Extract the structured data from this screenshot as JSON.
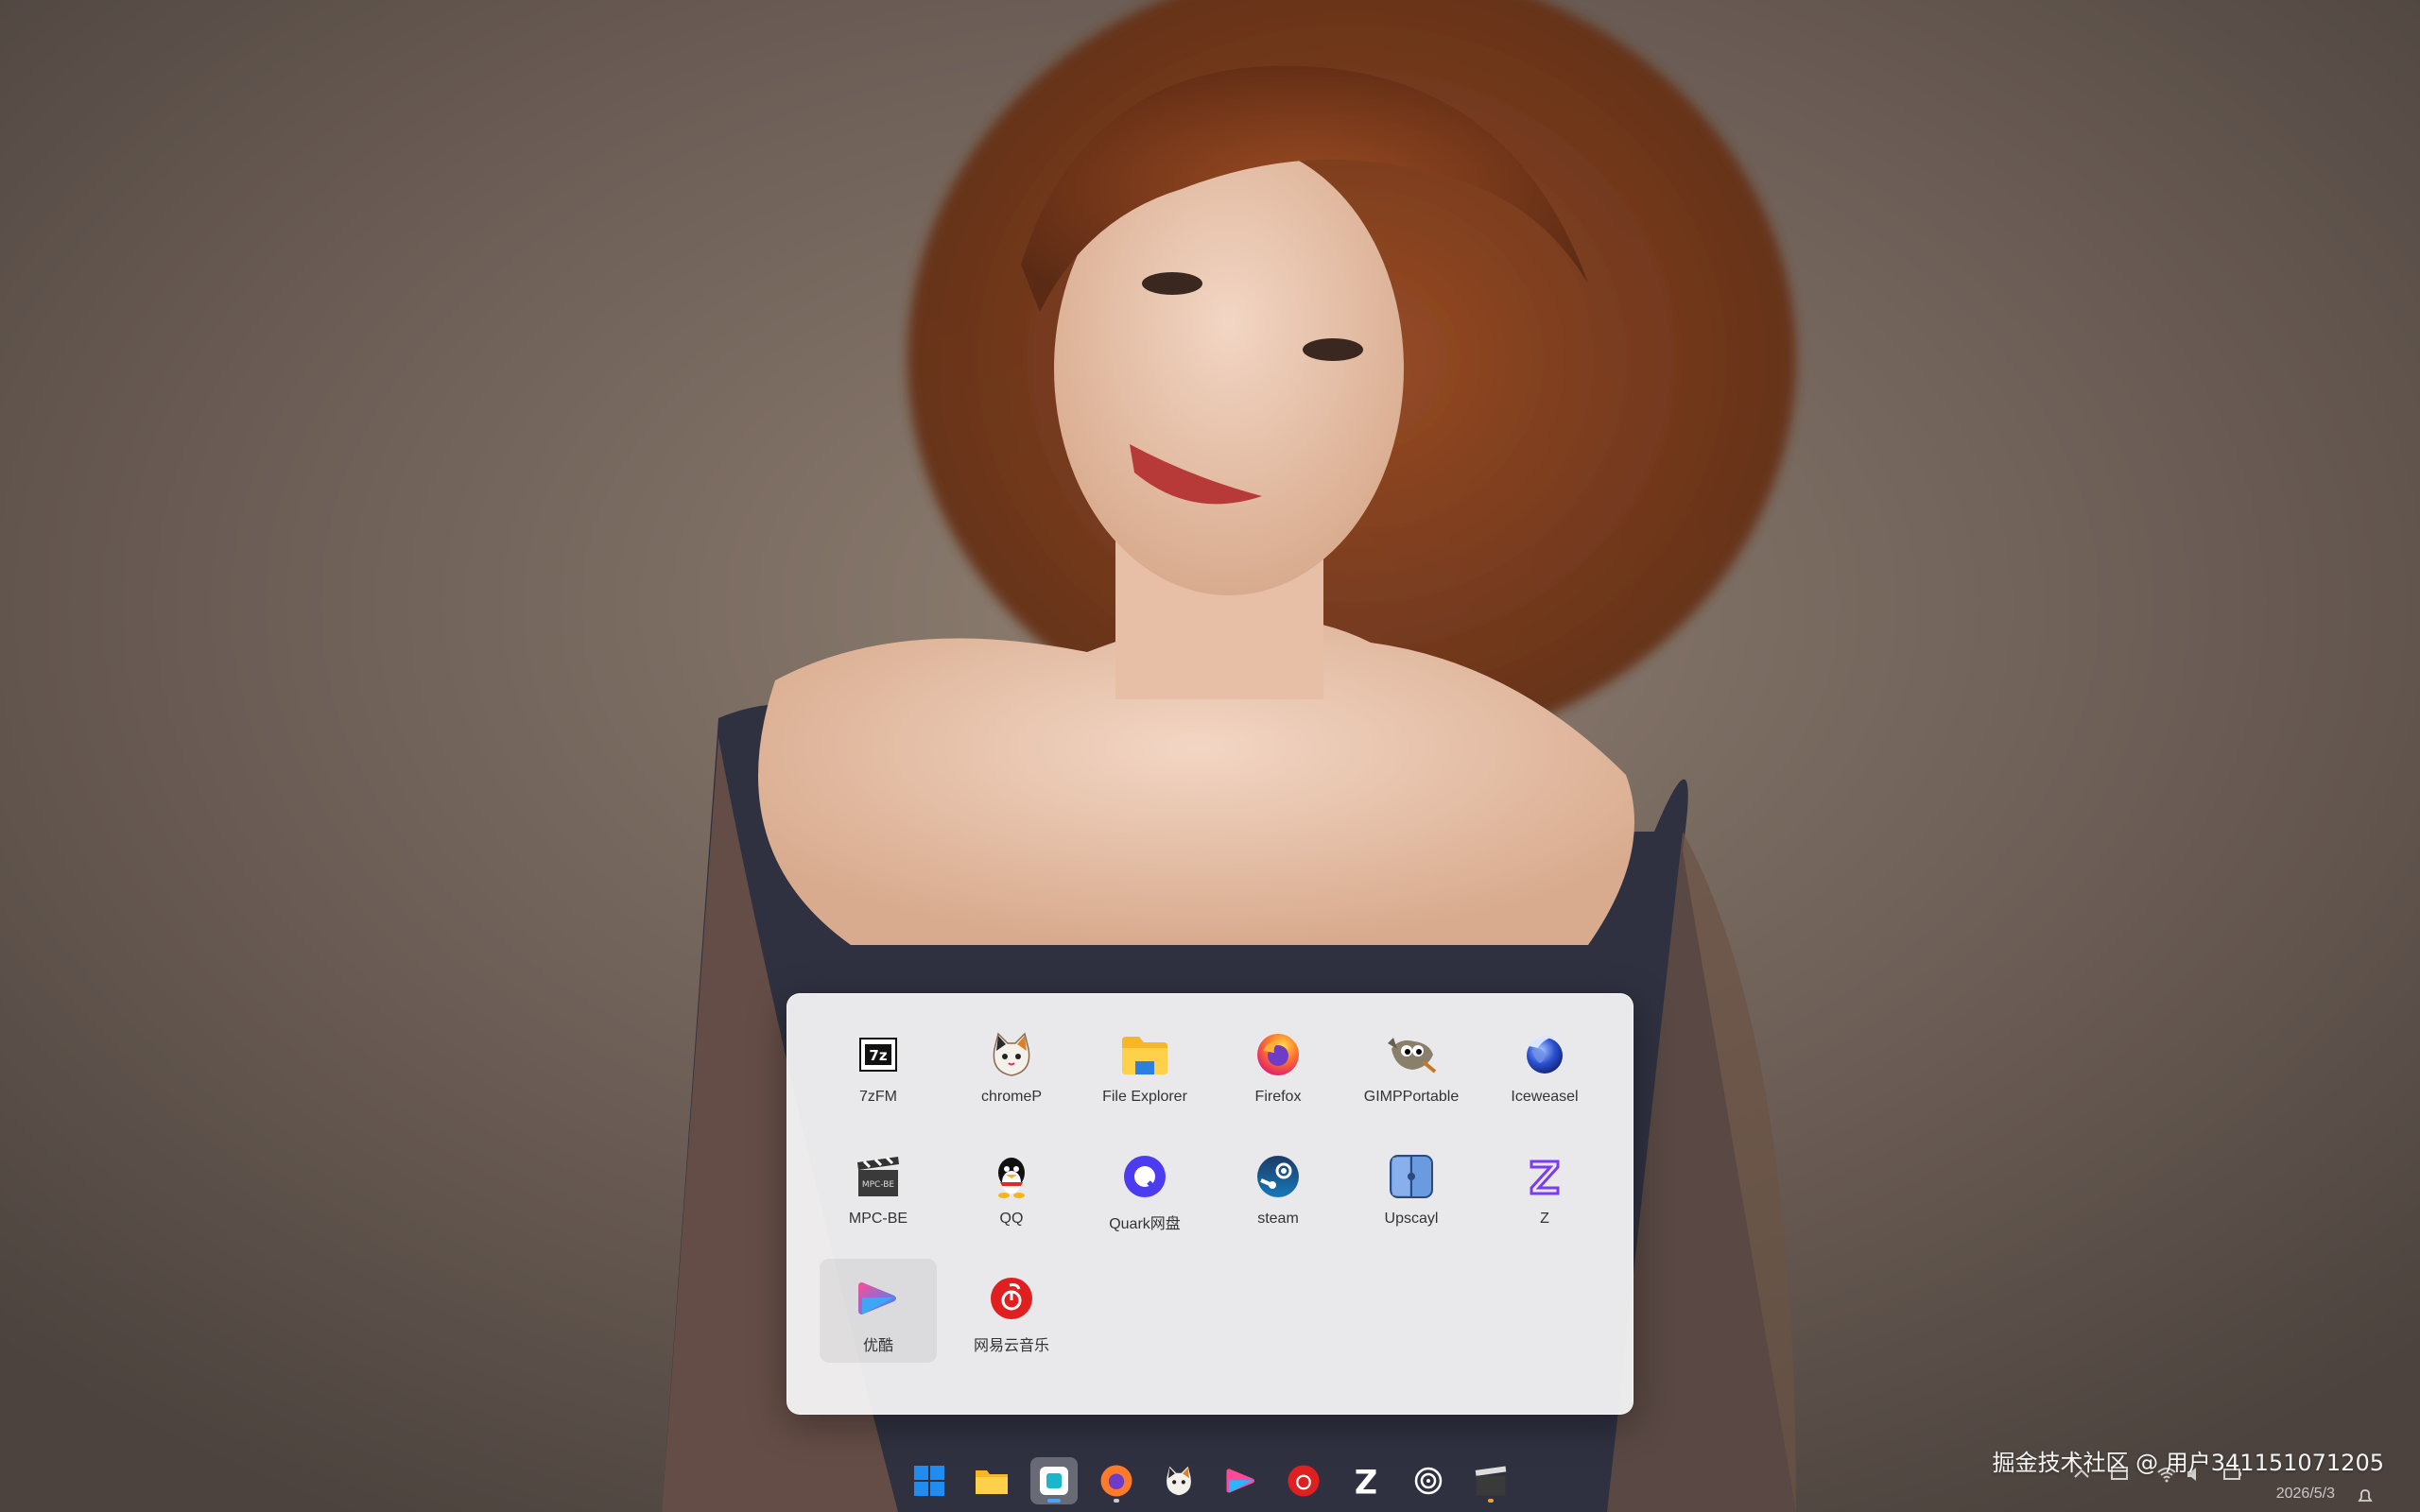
{
  "launcher": {
    "apps": [
      {
        "label": "7zFM",
        "icon": "7zip-icon"
      },
      {
        "label": "chromeP",
        "icon": "cat-icon"
      },
      {
        "label": "File Explorer",
        "icon": "folder-icon"
      },
      {
        "label": "Firefox",
        "icon": "firefox-icon"
      },
      {
        "label": "GIMPPortable",
        "icon": "gimp-icon"
      },
      {
        "label": "Iceweasel",
        "icon": "globe-icon"
      },
      {
        "label": "MPC-BE",
        "icon": "clapperboard-icon"
      },
      {
        "label": "QQ",
        "icon": "penguin-icon"
      },
      {
        "label": "Quark网盘",
        "icon": "quark-icon"
      },
      {
        "label": "steam",
        "icon": "steam-icon"
      },
      {
        "label": "Upscayl",
        "icon": "upscayl-icon"
      },
      {
        "label": "Z",
        "icon": "z-icon"
      },
      {
        "label": "优酷",
        "icon": "youku-icon",
        "selected": true
      },
      {
        "label": "网易云音乐",
        "icon": "netease-music-icon"
      }
    ]
  },
  "taskbar": {
    "items": [
      "start-icon",
      "file-explorer-icon",
      "launcher-icon",
      "firefox-icon",
      "cat-icon",
      "youku-icon",
      "netease-music-icon",
      "z-icon",
      "target-icon",
      "mpc-icon"
    ]
  },
  "tray": {
    "date": "2026/5/3"
  },
  "watermark": "掘金技术社区 @ 用户341151071205",
  "colors": {
    "accent": "#4aa3ff",
    "launcher_bg": "#f7f7f9"
  }
}
